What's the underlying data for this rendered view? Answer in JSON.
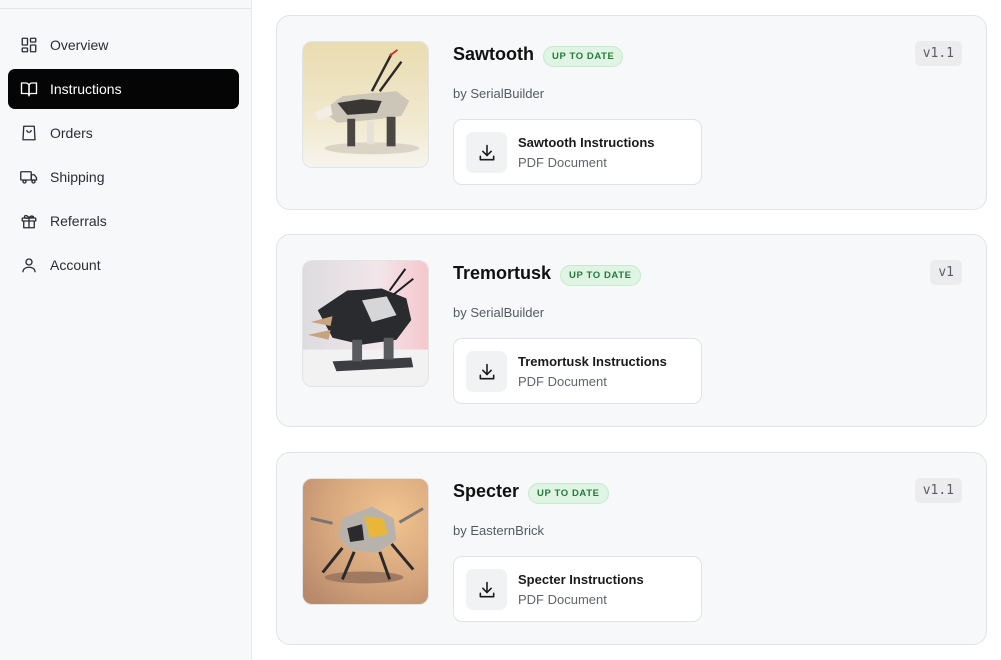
{
  "sidebar": {
    "items": [
      {
        "label": "Overview",
        "icon": "grid-icon",
        "active": false
      },
      {
        "label": "Instructions",
        "icon": "book-open-icon",
        "active": true
      },
      {
        "label": "Orders",
        "icon": "shopping-bag-icon",
        "active": false
      },
      {
        "label": "Shipping",
        "icon": "truck-icon",
        "active": false
      },
      {
        "label": "Referrals",
        "icon": "gift-icon",
        "active": false
      },
      {
        "label": "Account",
        "icon": "user-icon",
        "active": false
      }
    ]
  },
  "cards": [
    {
      "title": "Sawtooth",
      "badge": "UP TO DATE",
      "author": "by SerialBuilder",
      "version": "v1.1",
      "download": {
        "name": "Sawtooth Instructions",
        "type": "PDF Document",
        "icon": "download-icon"
      },
      "image": "sawtooth-model-photo"
    },
    {
      "title": "Tremortusk",
      "badge": "UP TO DATE",
      "author": "by SerialBuilder",
      "version": "v1",
      "download": {
        "name": "Tremortusk Instructions",
        "type": "PDF Document",
        "icon": "download-icon"
      },
      "image": "tremortusk-model-photo"
    },
    {
      "title": "Specter",
      "badge": "UP TO DATE",
      "author": "by EasternBrick",
      "version": "v1.1",
      "download": {
        "name": "Specter Instructions",
        "type": "PDF Document",
        "icon": "download-icon"
      },
      "image": "specter-model-photo"
    }
  ],
  "colors": {
    "active_nav_bg": "#050505",
    "badge_bg": "#dff4e3",
    "badge_text": "#257a3b",
    "card_bg": "#f7f8fa"
  }
}
